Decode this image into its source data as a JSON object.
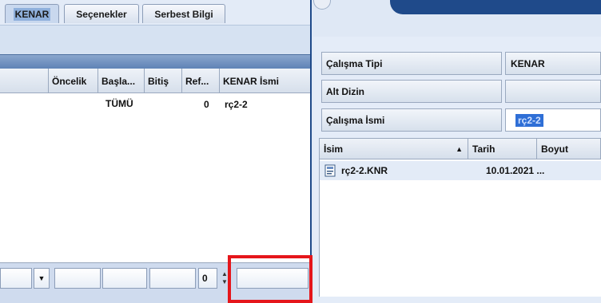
{
  "tabs": [
    {
      "label": "KENAR",
      "active": true
    },
    {
      "label": "Seçenekler",
      "active": false
    },
    {
      "label": "Serbest Bilgi",
      "active": false
    }
  ],
  "grid": {
    "columns": [
      "Öncelik",
      "Başla...",
      "Bitiş",
      "Ref...",
      "KENAR İsmi"
    ],
    "rows": [
      {
        "oncelik": "",
        "basla": "TÜMÜ",
        "bitis": "",
        "ref": "0",
        "kenar_ismi": "rç2-2"
      }
    ]
  },
  "footer": {
    "counter_value": "0"
  },
  "properties": [
    {
      "label": "Çalışma Tipi",
      "value": "KENAR"
    },
    {
      "label": "Alt Dizin",
      "value": ""
    },
    {
      "label": "Çalışma İsmi",
      "value": "rç2-2"
    }
  ],
  "file_list": {
    "columns": [
      {
        "label": "İsim",
        "sort": "ascending"
      },
      {
        "label": "Tarih"
      },
      {
        "label": "Boyut"
      }
    ],
    "rows": [
      {
        "name": "rç2-2.KNR",
        "date": "10.01.2021 ...",
        "size": ""
      }
    ]
  },
  "icons": {
    "dropdown": "chevron-down-icon",
    "sort": "sort-ascending-icon",
    "file": "file-icon",
    "spinner": "spinner-arrows-icon"
  },
  "colors": {
    "accent_blue": "#1f4a8a",
    "selection_blue": "#2f6fd6",
    "highlight_red": "#e5161b"
  }
}
